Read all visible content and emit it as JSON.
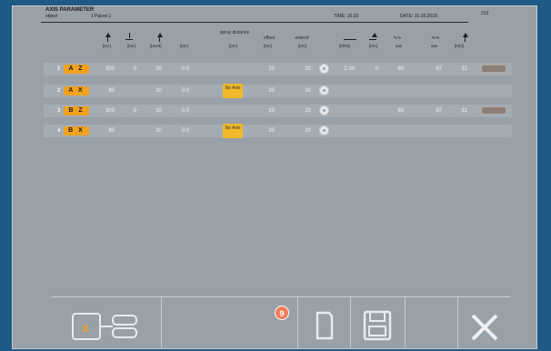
{
  "header": {
    "title": "AXIS PARAMETER",
    "object_label": "object",
    "object_value": "1 Palset 1",
    "time": "TIME: 16:20",
    "date": "DATE: 15.03.2018",
    "code": "313"
  },
  "columns": {
    "unit_mm1": "[bm]",
    "unit_mm2": "[bm]",
    "unit_mm3": "[bm/d]",
    "unit_mm4": "[bm]",
    "safety_distance": "spray distance",
    "safety_unit": "[bm]",
    "offset": "offset",
    "offset_unit": "[bm]",
    "extend": "extend",
    "extend_unit": "[bm]",
    "col_a": "[bf/Nt]",
    "col_b": "[bm]",
    "col_c": "aas",
    "col_d": "aas",
    "col_e": "[bf/d]"
  },
  "rows": [
    {
      "num": "1",
      "axis": "A Z",
      "v1": "300",
      "v2": "0",
      "v3": "10",
      "v4": "0.0",
      "noaxis": "",
      "off": "20",
      "ext": "20",
      "c1": "2.00",
      "c2": "0",
      "c3": "60",
      "c4": "97",
      "c5": "31",
      "pill": true
    },
    {
      "num": "2",
      "axis": "A X",
      "v1": "80",
      "v2": "",
      "v3": "10",
      "v4": "0.0",
      "noaxis": "No Axis",
      "off": "20",
      "ext": "30",
      "c1": "",
      "c2": "",
      "c3": "",
      "c4": "",
      "c5": "",
      "pill": false
    },
    {
      "num": "3",
      "axis": "B Z",
      "v1": "300",
      "v2": "0",
      "v3": "10",
      "v4": "0.0",
      "noaxis": "",
      "off": "20",
      "ext": "20",
      "c1": "",
      "c2": "",
      "c3": "60",
      "c4": "97",
      "c5": "31",
      "pill": true
    },
    {
      "num": "4",
      "axis": "B X",
      "v1": "80",
      "v2": "",
      "v3": "10",
      "v4": "0.0",
      "noaxis": "No Axis",
      "off": "20",
      "ext": "20",
      "c1": "",
      "c2": "",
      "c3": "",
      "c4": "",
      "c5": "",
      "pill": false
    }
  ],
  "toolbar": {
    "notification_count": "9",
    "colors": {
      "accent": "#f0a21f",
      "panel": "#98a0a8",
      "frame": "#1f5a86"
    }
  },
  "icons": [
    "axis-switch-icon",
    "document-icon",
    "save-icon",
    "close-icon"
  ]
}
